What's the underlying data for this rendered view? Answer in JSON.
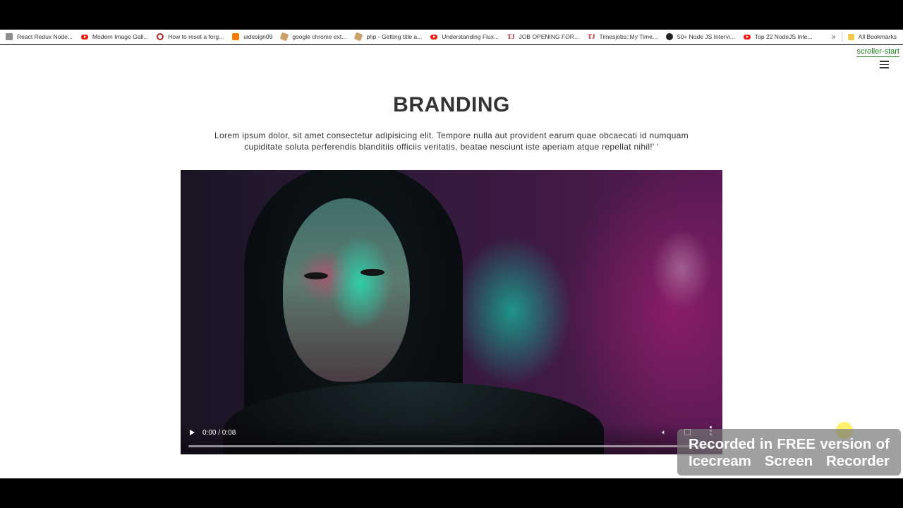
{
  "bookmarks_bar": {
    "items": [
      {
        "label": "React Redux Node...",
        "icon": "page-icon"
      },
      {
        "label": "Modern Image Gall...",
        "icon": "youtube-icon"
      },
      {
        "label": "How to reset a forg...",
        "icon": "quora-icon"
      },
      {
        "label": "uidesign09",
        "icon": "blogger-icon"
      },
      {
        "label": "google chrome ext...",
        "icon": "hand-icon"
      },
      {
        "label": "php - Getting title a...",
        "icon": "hand-icon"
      },
      {
        "label": "Understanding Flux...",
        "icon": "youtube-icon"
      },
      {
        "label": "JOB OPENING FOR...",
        "icon": "tj-icon"
      },
      {
        "label": "Timesjobs::My Time...",
        "icon": "tj-icon"
      },
      {
        "label": "50+ Node JS Intervi...",
        "icon": "github-icon"
      },
      {
        "label": "Top 22 NodeJS Inte...",
        "icon": "youtube-icon"
      }
    ],
    "overflow_label": "»",
    "all_bookmarks_label": "All Bookmarks",
    "tj_glyph": "TJ"
  },
  "page": {
    "scroller_label": "scroller-start",
    "heading": "BRANDING",
    "paragraph": "Lorem ipsum dolor, sit amet consectetur adipisicing elit. Tempore nulla aut provident earum quae obcaecati id numquam cupiditate soluta perferendis blanditiis officiis veritatis, beatae nesciunt iste aperiam atque repellat nihil!' '"
  },
  "video": {
    "time_display": "0:00 / 0:08",
    "progress": 0.0
  },
  "watermark": {
    "line1": "Recorded in FREE version of",
    "line2": "Icecream Screen Recorder"
  }
}
